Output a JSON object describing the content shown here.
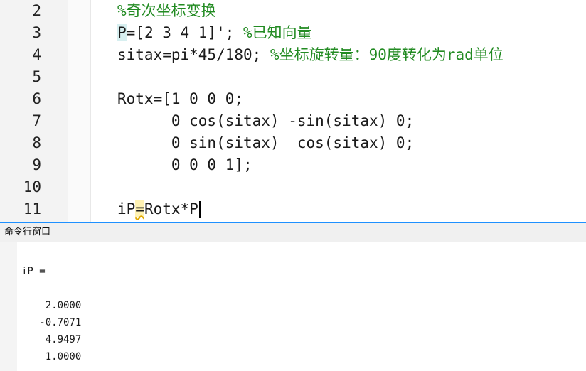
{
  "editor": {
    "lines": [
      {
        "num": "2",
        "parts": [
          {
            "t": "%奇次坐标变换",
            "c": "cmt"
          }
        ]
      },
      {
        "num": "3",
        "parts": [
          {
            "t": "P",
            "c": "hl-p"
          },
          {
            "t": "=[2 3 4 1]'; "
          },
          {
            "t": "%已知向量",
            "c": "cmt"
          }
        ]
      },
      {
        "num": "4",
        "parts": [
          {
            "t": "sitax=pi*45/180; "
          },
          {
            "t": "%坐标旋转量：90度转化为rad单位",
            "c": "cmt"
          }
        ]
      },
      {
        "num": "5",
        "parts": []
      },
      {
        "num": "6",
        "parts": [
          {
            "t": "Rotx=[1 0 0 0;"
          }
        ]
      },
      {
        "num": "7",
        "parts": [
          {
            "t": "      0 cos(sitax) -sin(sitax) 0;"
          }
        ]
      },
      {
        "num": "8",
        "parts": [
          {
            "t": "      0 sin(sitax)  cos(sitax) 0;"
          }
        ]
      },
      {
        "num": "9",
        "parts": [
          {
            "t": "      0 0 0 1];"
          }
        ]
      },
      {
        "num": "10",
        "parts": []
      },
      {
        "num": "11",
        "parts": [
          {
            "t": "iP"
          },
          {
            "t": "=",
            "c": "warn-eq"
          },
          {
            "t": "Rotx*P"
          },
          {
            "t": "",
            "c": "caret"
          }
        ]
      }
    ]
  },
  "command_window": {
    "title": "命令行窗口",
    "var_line": "iP =",
    "values": [
      "    2.0000",
      "   -0.7071",
      "    4.9497",
      "    1.0000"
    ]
  }
}
